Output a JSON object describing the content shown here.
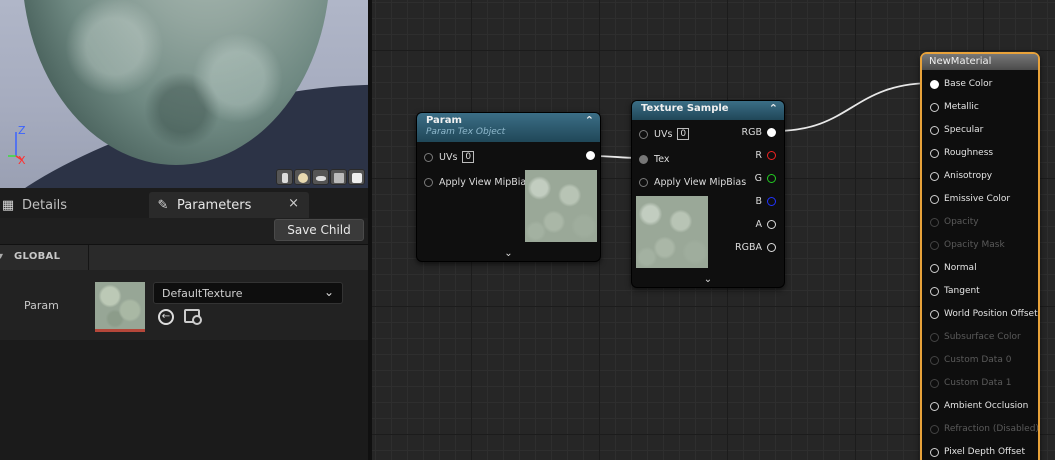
{
  "viewport": {
    "axis_z": "Z",
    "axis_x": "X",
    "preview_buttons": [
      "cylinder-icon",
      "sphere-icon",
      "plane-icon",
      "cube-icon",
      "teapot-icon"
    ]
  },
  "panel": {
    "tabs": [
      {
        "label": "Details",
        "icon": "grid-icon"
      },
      {
        "label": "Parameters",
        "icon": "pencil-icon"
      }
    ],
    "close": "×",
    "save_child": "Save Child",
    "global_label": "GLOBAL",
    "param_label": "Param",
    "texture_value": "DefaultTexture"
  },
  "graph": {
    "param_node": {
      "title": "Param",
      "subtitle": "Param Tex Object",
      "pins_in": [
        "UVs",
        "Apply View MipBias"
      ],
      "uv_value": "0"
    },
    "tex_node": {
      "title": "Texture Sample",
      "pins_in": [
        "UVs",
        "Tex",
        "Apply View MipBias"
      ],
      "uv_value": "0",
      "pins_out": [
        "RGB",
        "R",
        "G",
        "B",
        "A",
        "RGBA"
      ]
    },
    "material_node": {
      "title": "NewMaterial",
      "pins": [
        {
          "label": "Base Color",
          "enabled": true
        },
        {
          "label": "Metallic",
          "enabled": true
        },
        {
          "label": "Specular",
          "enabled": true
        },
        {
          "label": "Roughness",
          "enabled": true
        },
        {
          "label": "Anisotropy",
          "enabled": true
        },
        {
          "label": "Emissive Color",
          "enabled": true
        },
        {
          "label": "Opacity",
          "enabled": false
        },
        {
          "label": "Opacity Mask",
          "enabled": false
        },
        {
          "label": "Normal",
          "enabled": true
        },
        {
          "label": "Tangent",
          "enabled": true
        },
        {
          "label": "World Position Offset",
          "enabled": true
        },
        {
          "label": "Subsurface Color",
          "enabled": false
        },
        {
          "label": "Custom Data 0",
          "enabled": false
        },
        {
          "label": "Custom Data 1",
          "enabled": false
        },
        {
          "label": "Ambient Occlusion",
          "enabled": true
        },
        {
          "label": "Refraction (Disabled)",
          "enabled": false
        },
        {
          "label": "Pixel Depth Offset",
          "enabled": true
        }
      ]
    }
  },
  "colors": {
    "node_header": "#2b5d73",
    "material_outline": "#e8a23a",
    "pin_red": "#ee2222",
    "pin_green": "#22cc22",
    "pin_blue": "#2233ff"
  }
}
